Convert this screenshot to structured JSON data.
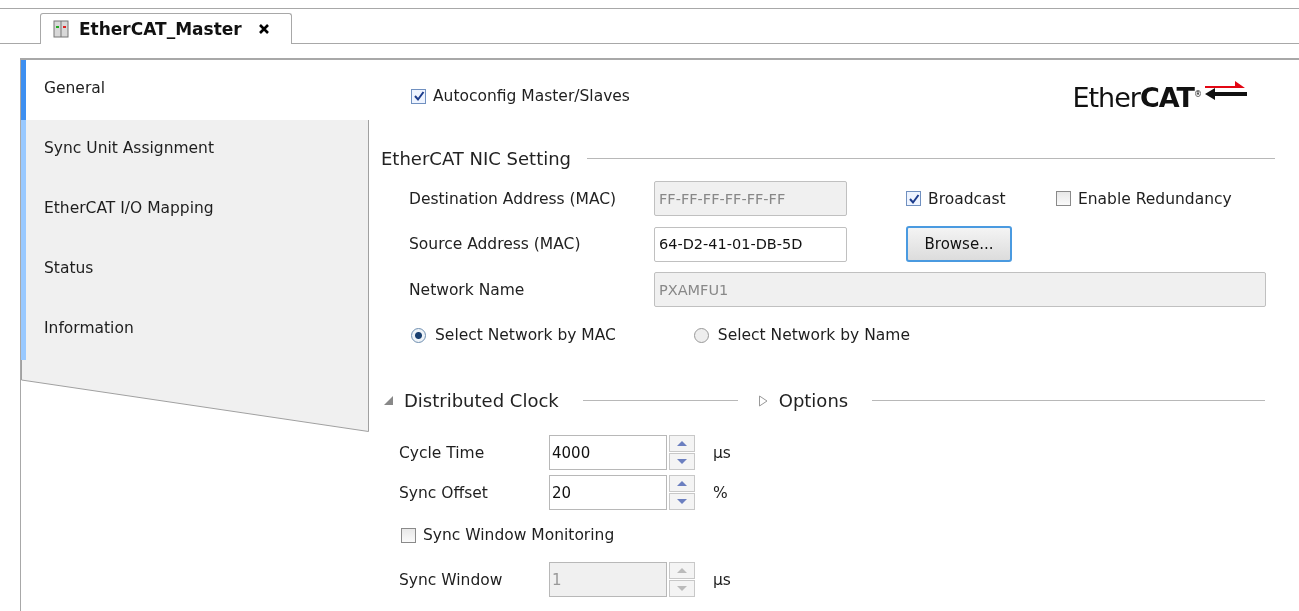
{
  "editor_tab": {
    "title": "EtherCAT_Master",
    "selected": true
  },
  "sidebar": {
    "items": [
      {
        "label": "General",
        "selected": true
      },
      {
        "label": "Sync Unit Assignment",
        "selected": false
      },
      {
        "label": "EtherCAT I/O Mapping",
        "selected": false
      },
      {
        "label": "Status",
        "selected": false
      },
      {
        "label": "Information",
        "selected": false
      }
    ]
  },
  "autoconfig": {
    "label": "Autoconfig Master/Slaves",
    "checked": true
  },
  "logo": "Ether**CAT**$^{®}$",
  "nic_setting": {
    "title": "EtherCAT NIC Setting",
    "destination": {
      "label": "Destination Address (MAC)",
      "value": "FF-FF-FF-FF-FF-FF",
      "disabled": true
    },
    "broadcast": {
      "label": "Broadcast",
      "checked": true
    },
    "redundancy": {
      "label": "Enable Redundancy",
      "checked": false
    },
    "source": {
      "label": "Source Address (MAC)",
      "value": "64-D2-41-01-DB-5D",
      "disabled": false
    },
    "browse_button": "Browse...",
    "network_name": {
      "label": "Network Name",
      "value": "PXAMFU1",
      "disabled": true
    },
    "select_by": [
      {
        "label": "Select Network by MAC",
        "selected": true
      },
      {
        "label": "Select Network by Name",
        "selected": false
      }
    ]
  },
  "distributed_clock": {
    "title": "Distributed Clock",
    "expanded": true
  },
  "options": {
    "title": "Options",
    "expanded": false
  },
  "clock_fields": [
    {
      "kind": "spin",
      "label": "Cycle Time",
      "value": "4000",
      "unit": "µs",
      "disabled": false
    },
    {
      "kind": "spin",
      "label": "Sync Offset",
      "value": "20",
      "unit": "%",
      "disabled": false
    },
    {
      "kind": "checkbox",
      "label": "Sync Window Monitoring",
      "checked": false
    },
    {
      "kind": "spin",
      "label": "Sync Window",
      "value": "1",
      "unit": "µs",
      "disabled": true
    }
  ]
}
